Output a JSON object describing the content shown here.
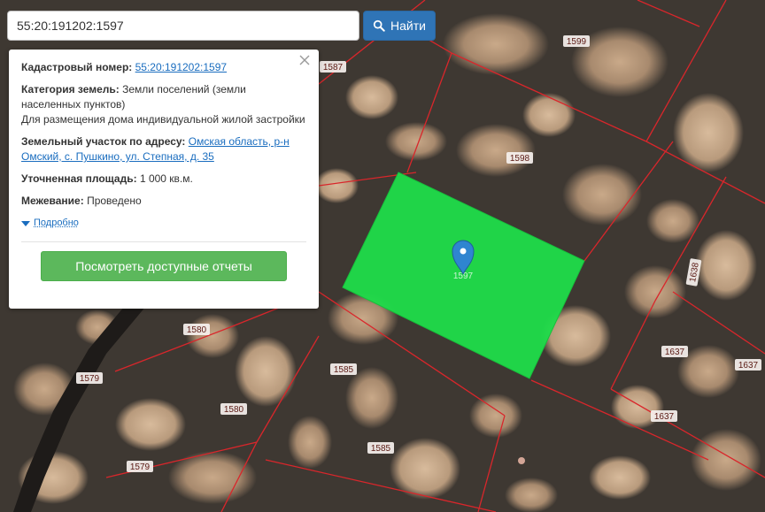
{
  "search": {
    "value": "55:20:191202:1597",
    "button_label": "Найти"
  },
  "popup": {
    "cadastral_label": "Кадастровый номер:",
    "cadastral_value": "55:20:191202:1597",
    "category_label": "Категория земель:",
    "category_value": "Земли поселений (земли населенных пунктов)",
    "usage": "Для размещения дома индивидуальной жилой застройки",
    "address_label": "Земельный участок по адресу:",
    "address_value": "Омская область, р-н Омский, с. Пушкино, ул. Степная, д. 35",
    "area_label": "Уточненная площадь:",
    "area_value": "1 000 кв.м.",
    "survey_label": "Межевание:",
    "survey_value": "Проведено",
    "more_label": "Подробно",
    "reports_button": "Посмотреть доступные отчеты"
  },
  "map": {
    "selected_plot_label": "1597",
    "selected_color": "#1fdc4a",
    "boundary_color": "#d9262b",
    "parcel_labels": [
      "1599",
      "1587",
      "1598",
      "1638",
      "1580",
      "1585",
      "1637",
      "1637",
      "1637",
      "1579",
      "1580",
      "1579",
      "1585"
    ]
  }
}
